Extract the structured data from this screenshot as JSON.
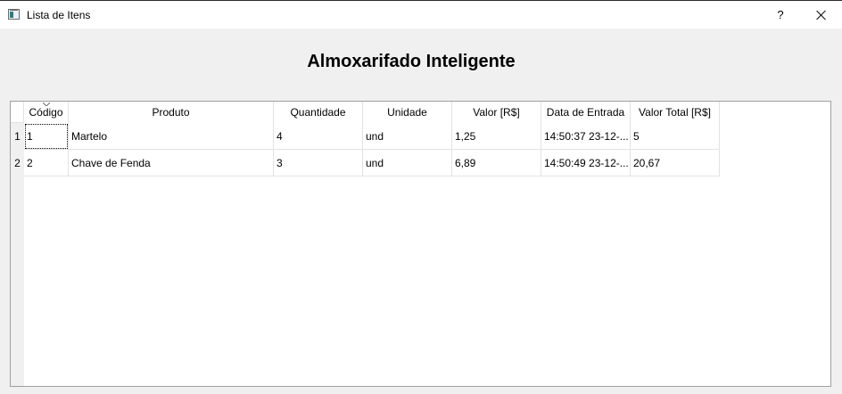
{
  "window": {
    "title": "Lista de Itens",
    "help_label": "?"
  },
  "heading": "Almoxarifado Inteligente",
  "table": {
    "columns": [
      "Código",
      "Produto",
      "Quantidade",
      "Unidade",
      "Valor [R$]",
      "Data de Entrada",
      "Valor Total [R$]"
    ],
    "rows": [
      {
        "num": "1",
        "cells": [
          "1",
          "Martelo",
          "4",
          "und",
          "1,25",
          "14:50:37 23-12-...",
          "5"
        ]
      },
      {
        "num": "2",
        "cells": [
          "2",
          "Chave de Fenda",
          "3",
          "und",
          "6,89",
          "14:50:49 23-12-...",
          "20,67"
        ]
      }
    ]
  }
}
